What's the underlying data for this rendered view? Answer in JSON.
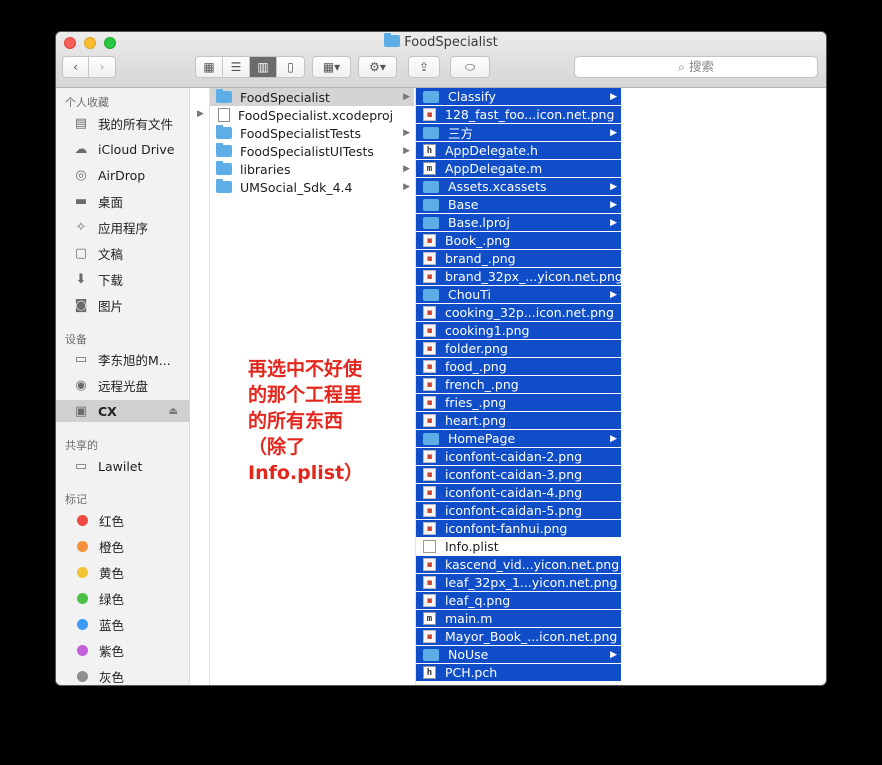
{
  "window": {
    "title": "FoodSpecialist"
  },
  "search": {
    "placeholder": "搜索"
  },
  "sidebar": {
    "sections": [
      {
        "heading": "个人收藏",
        "items": [
          {
            "label": "我的所有文件",
            "icon": "all-files-icon"
          },
          {
            "label": "iCloud Drive",
            "icon": "cloud-icon"
          },
          {
            "label": "AirDrop",
            "icon": "airdrop-icon"
          },
          {
            "label": "桌面",
            "icon": "desktop-icon"
          },
          {
            "label": "应用程序",
            "icon": "applications-icon"
          },
          {
            "label": "文稿",
            "icon": "document-icon"
          },
          {
            "label": "下载",
            "icon": "download-icon"
          },
          {
            "label": "图片",
            "icon": "camera-icon"
          }
        ]
      },
      {
        "heading": "设备",
        "items": [
          {
            "label": "李东旭的M...",
            "icon": "computer-icon"
          },
          {
            "label": "远程光盘",
            "icon": "disc-icon"
          },
          {
            "label": "CX",
            "icon": "drive-icon"
          }
        ]
      },
      {
        "heading": "共享的",
        "items": [
          {
            "label": "Lawilet",
            "icon": "computer-icon"
          }
        ]
      },
      {
        "heading": "标记",
        "items": [
          {
            "label": "红色",
            "color": "#f04a40"
          },
          {
            "label": "橙色",
            "color": "#f5913a"
          },
          {
            "label": "黄色",
            "color": "#f4c235"
          },
          {
            "label": "绿色",
            "color": "#4cc146"
          },
          {
            "label": "蓝色",
            "color": "#3c9cf5"
          },
          {
            "label": "紫色",
            "color": "#c260d9"
          },
          {
            "label": "灰色",
            "color": "#8f8f8f"
          }
        ]
      }
    ]
  },
  "column1": [
    {
      "name": "FoodSpecialist",
      "kind": "folder"
    },
    {
      "name": "FoodSpecialist.xcodeproj",
      "kind": "file"
    },
    {
      "name": "FoodSpecialistTests",
      "kind": "folder"
    },
    {
      "name": "FoodSpecialistUITests",
      "kind": "folder"
    },
    {
      "name": "libraries",
      "kind": "folder"
    },
    {
      "name": "UMSocial_Sdk_4.4",
      "kind": "folder"
    }
  ],
  "column2": [
    {
      "name": "Classify",
      "kind": "folder"
    },
    {
      "name": "128_fast_foo...icon.net.png",
      "kind": "png"
    },
    {
      "name": "三方",
      "kind": "folder"
    },
    {
      "name": "AppDelegate.h",
      "kind": "h"
    },
    {
      "name": "AppDelegate.m",
      "kind": "m"
    },
    {
      "name": "Assets.xcassets",
      "kind": "folder"
    },
    {
      "name": "Base",
      "kind": "folder"
    },
    {
      "name": "Base.lproj",
      "kind": "folder"
    },
    {
      "name": "Book_.png",
      "kind": "png"
    },
    {
      "name": "brand_.png",
      "kind": "png"
    },
    {
      "name": "brand_32px_...yicon.net.png",
      "kind": "png"
    },
    {
      "name": "ChouTi",
      "kind": "folder"
    },
    {
      "name": "cooking_32p...icon.net.png",
      "kind": "png"
    },
    {
      "name": "cooking1.png",
      "kind": "png"
    },
    {
      "name": "folder.png",
      "kind": "png"
    },
    {
      "name": "food_.png",
      "kind": "png"
    },
    {
      "name": "french_.png",
      "kind": "png"
    },
    {
      "name": "fries_.png",
      "kind": "png"
    },
    {
      "name": "heart.png",
      "kind": "png"
    },
    {
      "name": "HomePage",
      "kind": "folder"
    },
    {
      "name": "iconfont-caidan-2.png",
      "kind": "png"
    },
    {
      "name": "iconfont-caidan-3.png",
      "kind": "png"
    },
    {
      "name": "iconfont-caidan-4.png",
      "kind": "png"
    },
    {
      "name": "iconfont-caidan-5.png",
      "kind": "png"
    },
    {
      "name": "iconfont-fanhui.png",
      "kind": "png"
    },
    {
      "name": "Info.plist",
      "kind": "plist",
      "selected": false
    },
    {
      "name": "kascend_vid...yicon.net.png",
      "kind": "png"
    },
    {
      "name": "leaf_32px_1...yicon.net.png",
      "kind": "png"
    },
    {
      "name": "leaf_q.png",
      "kind": "png"
    },
    {
      "name": "main.m",
      "kind": "m"
    },
    {
      "name": "Mayor_Book_...icon.net.png",
      "kind": "png"
    },
    {
      "name": "NoUse",
      "kind": "folder"
    },
    {
      "name": "PCH.pch",
      "kind": "h"
    }
  ],
  "annotation": {
    "text": "再选中不好使\n的那个工程里\n的所有东西\n（除了\nInfo.plist）"
  },
  "colors": {
    "selection": "#0f4ec8",
    "folder": "#5dade6",
    "annotation": "#e3271d"
  }
}
